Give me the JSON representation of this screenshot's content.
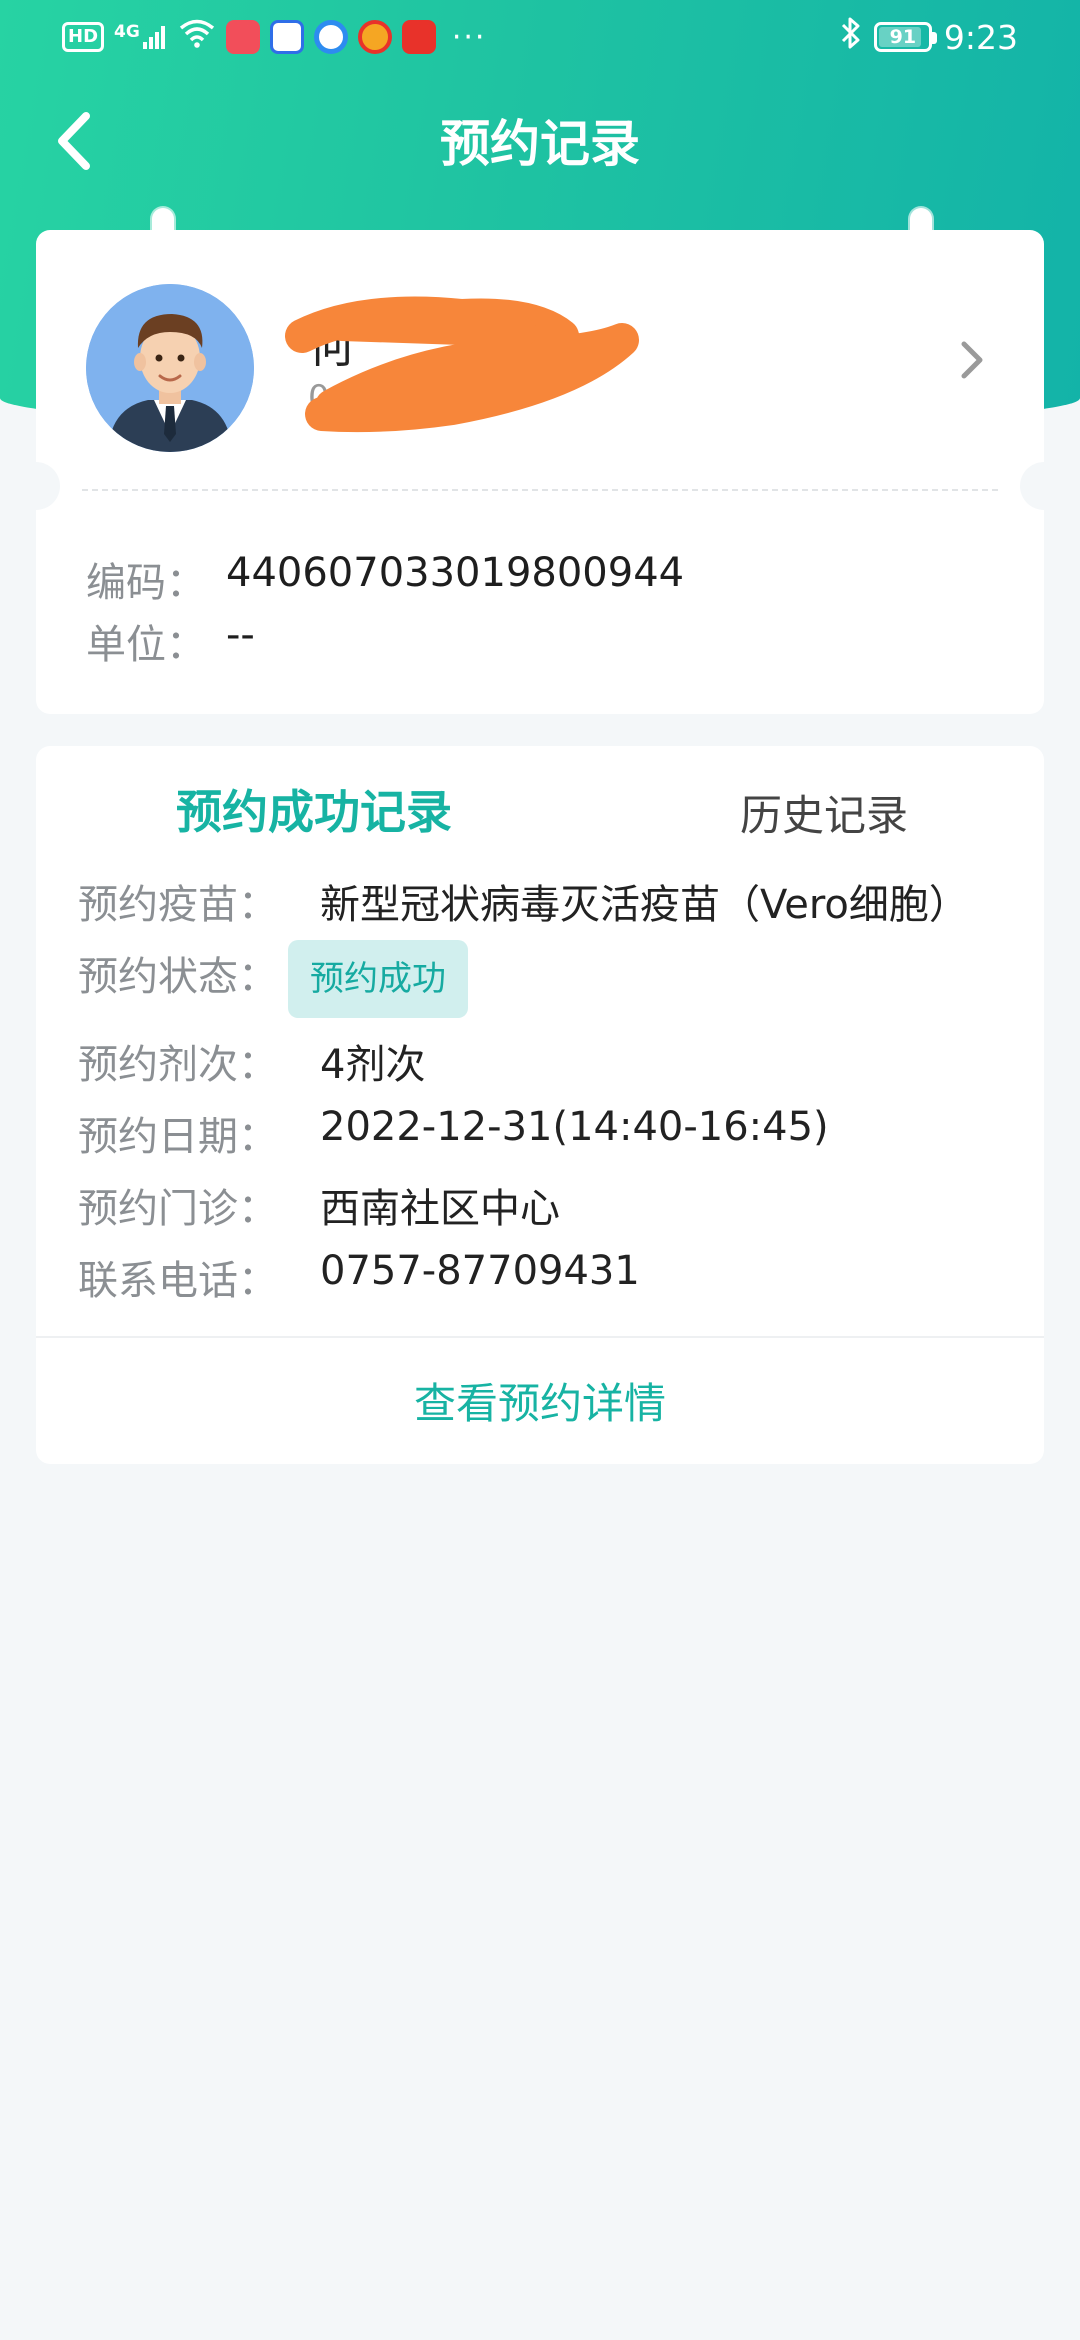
{
  "status_bar": {
    "hd": "HD",
    "network": "4G",
    "more": "···",
    "battery": "91",
    "time": "9:23"
  },
  "nav": {
    "title": "预约记录"
  },
  "profile": {
    "name_visible": "何",
    "subtitle_visible": "04-15",
    "code_label": "编码：",
    "code_value": "440607033019800944",
    "unit_label": "单位：",
    "unit_value": "--"
  },
  "tabs": [
    {
      "label": "预约成功记录",
      "active": true
    },
    {
      "label": "历史记录",
      "active": false
    }
  ],
  "record": {
    "vaccine_label": "预约疫苗：",
    "vaccine_value": "新型冠状病毒灭活疫苗（Vero细胞）",
    "status_label": "预约状态：",
    "status_value": "预约成功",
    "dose_label": "预约剂次：",
    "dose_value": "4剂次",
    "date_label": "预约日期：",
    "date_value": "2022-12-31(14:40-16:45)",
    "clinic_label": "预约门诊：",
    "clinic_value": "西南社区中心",
    "phone_label": "联系电话：",
    "phone_value": "0757-87709431",
    "detail_link": "查看预约详情"
  },
  "colors": {
    "accent": "#17b3a3",
    "header_start": "#27d3a3",
    "header_end": "#13b3a8",
    "badge_bg": "#d1efee",
    "redaction": "#f7863a"
  }
}
